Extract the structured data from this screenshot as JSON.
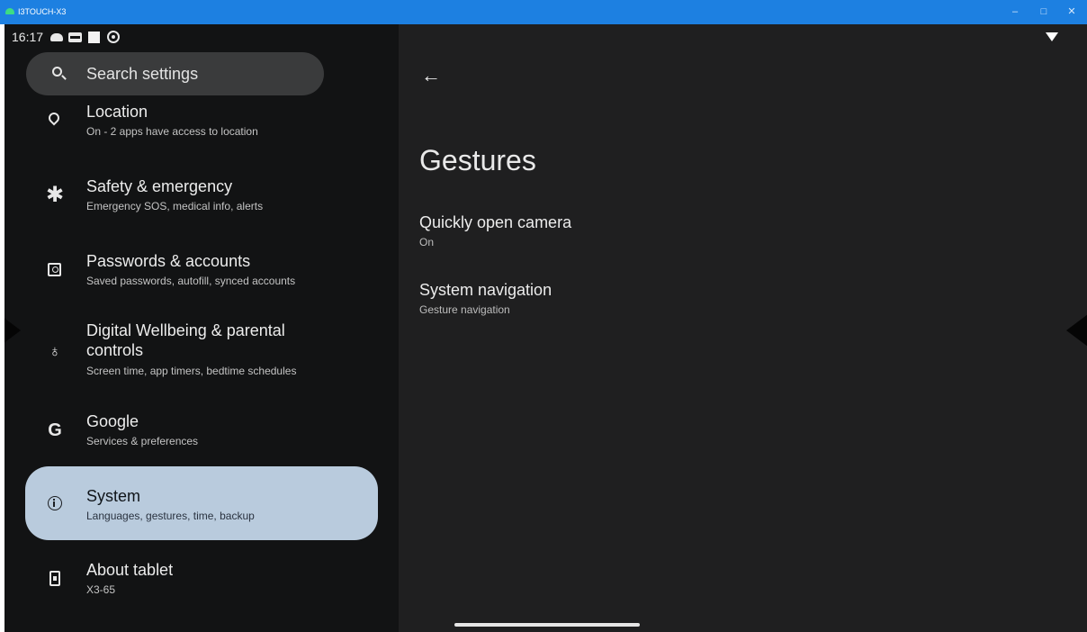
{
  "window": {
    "title": "I3TOUCH-X3",
    "controls": {
      "minimize": "–",
      "maximize": "□",
      "close": "✕"
    }
  },
  "status_bar": {
    "time": "16:17",
    "icons": [
      "cloud-icon",
      "hdmi-icon",
      "square-icon",
      "gear-icon",
      "wifi-icon"
    ]
  },
  "search": {
    "placeholder": "Search settings",
    "icon": "search-icon"
  },
  "settings_list": [
    {
      "label": "Location",
      "sub": "On - 2 apps have access to location",
      "icon": "location-pin-icon"
    },
    {
      "label": "Safety & emergency",
      "sub": "Emergency SOS, medical info, alerts",
      "icon": "asterisk-icon"
    },
    {
      "label": "Passwords & accounts",
      "sub": "Saved passwords, autofill, synced accounts",
      "icon": "account-box-icon"
    },
    {
      "label_line1": "Digital Wellbeing & parental",
      "label_line2": "controls",
      "sub": "Screen time, app timers, bedtime schedules",
      "icon": "wellbeing-icon"
    },
    {
      "label": "Google",
      "sub": "Services & preferences",
      "icon": "google-icon",
      "glyph": "G"
    },
    {
      "label": "System",
      "sub": "Languages, gestures, time, backup",
      "icon": "info-icon",
      "selected": true
    },
    {
      "label": "About tablet",
      "sub": "X3-65",
      "icon": "tablet-icon"
    }
  ],
  "detail": {
    "back_icon": "←",
    "title": "Gestures",
    "prefs": [
      {
        "title": "Quickly open camera",
        "summary": "On"
      },
      {
        "title": "System navigation",
        "summary": "Gesture navigation"
      }
    ]
  },
  "colors": {
    "titlebar": "#1d80e1",
    "left_pane": "#121314",
    "right_pane": "#1f1f20",
    "selected_item": "#b9cbdd"
  }
}
